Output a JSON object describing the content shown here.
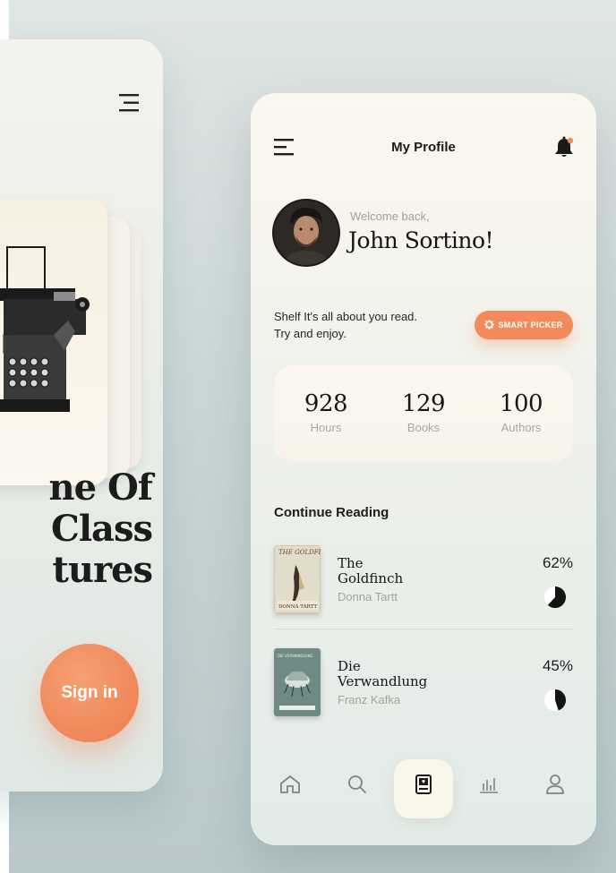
{
  "intro_screen": {
    "headline": "ne Of\nClass\ntures",
    "sign_in_label": "Sign in",
    "menu_icon": "hamburger-menu-icon",
    "illustration": "typewriter-illustration"
  },
  "profile_screen": {
    "header": {
      "title": "My Profile",
      "menu_icon": "hamburger-menu-icon",
      "notification_icon": "bell-icon"
    },
    "user": {
      "welcome": "Welcome back,",
      "name": "John Sortino!"
    },
    "shelf": {
      "tagline": "Shelf It's all about you read.\nTry and enjoy.",
      "smart_picker_label": "SMART PICKER",
      "smart_picker_icon": "gear-icon",
      "accent_color": "#f28a5b"
    },
    "stats": [
      {
        "value": "928",
        "label": "Hours"
      },
      {
        "value": "129",
        "label": "Books"
      },
      {
        "value": "100",
        "label": "Authors"
      }
    ],
    "continue_reading": {
      "title": "Continue Reading",
      "books": [
        {
          "title": "The\nGoldfinch",
          "author": "Donna Tartt",
          "progress_label": "62%",
          "progress": 0.62,
          "cover_icon": "goldfinch-cover",
          "cover_text": {
            "title": "THE GOLDFINCH",
            "author": "DONNA TARTT"
          }
        },
        {
          "title": "Die\nVerwandlung",
          "author": "Franz Kafka",
          "progress_label": "45%",
          "progress": 0.45,
          "cover_icon": "verwandlung-cover",
          "cover_text": {
            "title": "DIE VERWANDLUNG"
          }
        }
      ]
    },
    "nav": [
      {
        "name": "home",
        "icon": "home-icon",
        "active": false
      },
      {
        "name": "search",
        "icon": "search-icon",
        "active": false
      },
      {
        "name": "library",
        "icon": "book-icon",
        "active": true
      },
      {
        "name": "stats",
        "icon": "chart-icon",
        "active": false
      },
      {
        "name": "profile",
        "icon": "user-icon",
        "active": false
      }
    ]
  }
}
